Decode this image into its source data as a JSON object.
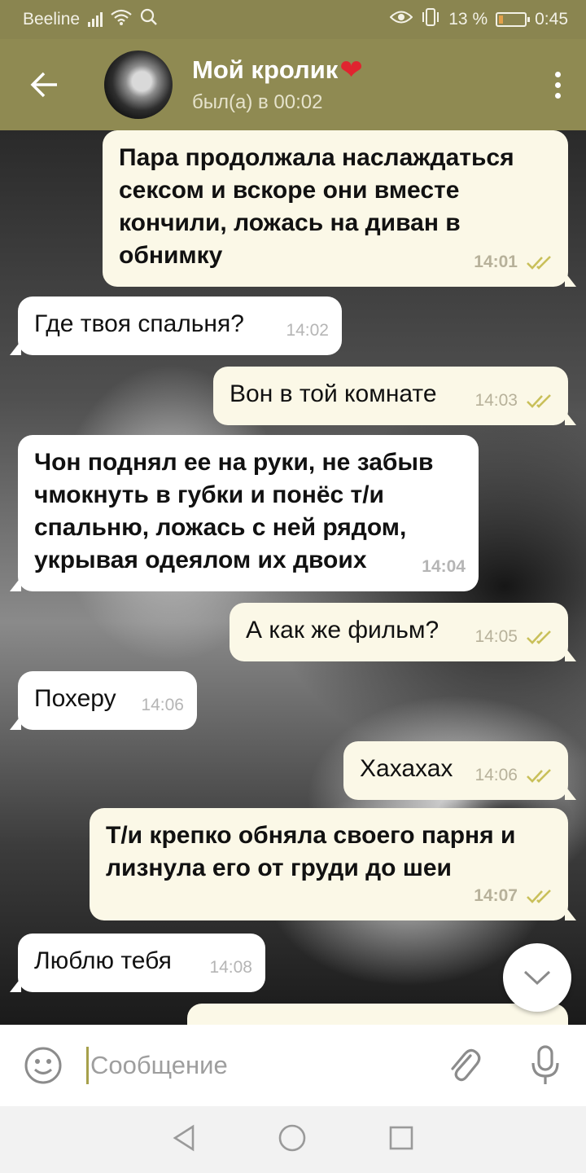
{
  "status_bar": {
    "carrier": "Beeline",
    "battery_percent": "13 %",
    "time": "0:45",
    "icons": [
      "signal-icon",
      "wifi-icon",
      "search-icon",
      "eye-icon",
      "vibrate-icon",
      "battery-icon"
    ]
  },
  "header": {
    "title": "Мой кролик",
    "title_emoji": "❤",
    "status": "был(а) в 00:02"
  },
  "messages": [
    {
      "dir": "out",
      "text": "Пара продолжала наслаждаться сексом и вскоре они вместе кончили, ложась на диван в обнимку",
      "time": "14:01",
      "read": true
    },
    {
      "dir": "in",
      "text": "Где твоя спальня?",
      "time": "14:02"
    },
    {
      "dir": "out",
      "text": "Вон в той комнате",
      "time": "14:03",
      "read": true
    },
    {
      "dir": "in",
      "text": "Чон поднял ее на руки, не забыв чмокнуть в губки и понёс т/и спальню, ложась с ней рядом, укрывая одеялом их двоих",
      "time": "14:04"
    },
    {
      "dir": "out",
      "text": "А как же фильм?",
      "time": "14:05",
      "read": true
    },
    {
      "dir": "in",
      "text": "Похеру",
      "time": "14:06"
    },
    {
      "dir": "out",
      "text": "Хахахах",
      "time": "14:06",
      "read": true
    },
    {
      "dir": "out",
      "text": "Т/и крепко обняла своего парня и лизнула его от груди до шеи",
      "time": "14:07",
      "read": true
    },
    {
      "dir": "in",
      "text": "Люблю тебя",
      "time": "14:08"
    }
  ],
  "input": {
    "placeholder": "Сообщение"
  },
  "colors": {
    "header_bg": "#8f8a52",
    "status_bg": "#8a8550",
    "outgoing_bubble": "#fbf8e7",
    "incoming_bubble": "#ffffff",
    "check_color": "#c9c05a"
  }
}
